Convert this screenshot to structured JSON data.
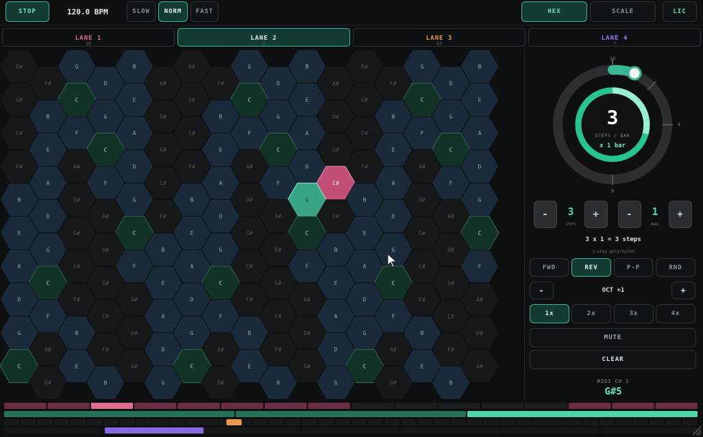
{
  "transport": {
    "stop_label": "STOP",
    "bpm": "120.0 BPM",
    "speeds": [
      {
        "label": "SLOW",
        "active": false
      },
      {
        "label": "NORM",
        "active": true
      },
      {
        "label": "FAST",
        "active": false
      }
    ]
  },
  "view_tabs": [
    {
      "label": "HEX",
      "active": true
    },
    {
      "label": "SCALE",
      "active": false
    }
  ],
  "lic_label": "LIC",
  "lanes": [
    {
      "name": "LANE 1",
      "count": "16",
      "color": "#e06c8f",
      "active": false
    },
    {
      "name": "LANE 2",
      "count": "3",
      "color": "#e6eef2",
      "active": true
    },
    {
      "name": "LANE 3",
      "count": "42",
      "color": "#e89a4f",
      "active": false
    },
    {
      "name": "LANE 4",
      "count": "7",
      "color": "#9a7cf0",
      "active": false
    }
  ],
  "grid": {
    "rows": [
      "D#,,G,,B,,D#,,G,,B,,D#,,G,,B",
      ",F#,,D,,A#,,F#,,D,,A#,,F#,,D,",
      "G#,,C,,E,,G#,,C,,E,,G#,,C,,E",
      ",B,,G,,D#,,B,,G,,D#,,B,,G,",
      "C#,,F,,A,,C#,,F,,A,,C#,,F,,A",
      ",E,,C,,G#,,E,,C,,G#,,E,,C,",
      "F#,,A#,,D,,F#,,A#,,D,,F#,,A#,,D",
      ",A,,F,,C#,,A,,F,,C#,,A,,F,",
      "B,,D#,,G,,B,,D#,,G,,B,,D#,,G",
      ",D,,A#,,F#,,D,,A#,,F#,,D,,A#,",
      "E,,G#,,C,,E,,G#,,C,,E,,G#,,C",
      ",G,,D#,,B,,G,,D#,,B,,G,,D#,",
      "A,,C#,,F,,A,,C#,,F,,A,,C#,,F",
      ",C,,G#,,E,,C,,G#,,E,,C,,G#,",
      "D,,F#,,A#,,D,,F#,,A#,,D,,F#,,A#",
      ",F,,C#,,A,,F,,C#,,A,,F,,C#,",
      "G,,B,,D#,,G,,B,,D#,,G,,B,,D#",
      ",A#,,F#,,D,,A#,,F#,,D,,A#,,F#,",
      "C,,E,,G#,,C,,E,,G#,,C,,E,,G#",
      ",D#,,B,,G,,D#,,B,,G,,D#,,B,"
    ],
    "active_note": "G#",
    "playing_note": "C",
    "active_cell": "8,10",
    "playing_cell": "7,11"
  },
  "dial": {
    "steps": "3",
    "steps_label": "STEPS / BAR",
    "bars_text": "x 1 bar",
    "tick_top": "16",
    "tick_right": "4",
    "tick_bottom": "8",
    "progress": 0.12
  },
  "steps_control": {
    "minus": "-",
    "value": "3",
    "label": "STEPS",
    "plus": "+"
  },
  "bars_control": {
    "minus": "-",
    "value": "1",
    "label": "BARS",
    "plus": "+"
  },
  "summary": "3 x 1 = 3 steps",
  "polyrhythm": "3-step polyrhythm",
  "directions": [
    {
      "label": "FWD",
      "active": false
    },
    {
      "label": "REV",
      "active": true
    },
    {
      "label": "P-P",
      "active": false
    },
    {
      "label": "RND",
      "active": false
    }
  ],
  "octave": {
    "minus": "-",
    "label": "OCT +1",
    "plus": "+"
  },
  "rates": [
    {
      "label": "1x",
      "active": true
    },
    {
      "label": "2x",
      "active": false
    },
    {
      "label": "3x",
      "active": false
    },
    {
      "label": "4x",
      "active": false
    }
  ],
  "mute_label": "MUTE",
  "clear_label": "CLEAR",
  "midi": {
    "channel": "MIDI CH 2",
    "note": "G#5"
  },
  "colors": {
    "accent": "#4fd6ad",
    "lane1": "#e06c8f",
    "lane3": "#e89a4f",
    "lane4": "#9a7cf0"
  },
  "timeline": {
    "lane1_steps": [
      "on",
      "on",
      "play",
      "on",
      "on",
      "on",
      "on",
      "on",
      "off",
      "off",
      "off",
      "off",
      "off",
      "on",
      "on",
      "on"
    ],
    "lane2_segments": [
      "done",
      "done",
      "current"
    ],
    "lane3_marker_fraction": 0.32,
    "lane4_fraction": [
      0.145,
      0.287
    ]
  }
}
